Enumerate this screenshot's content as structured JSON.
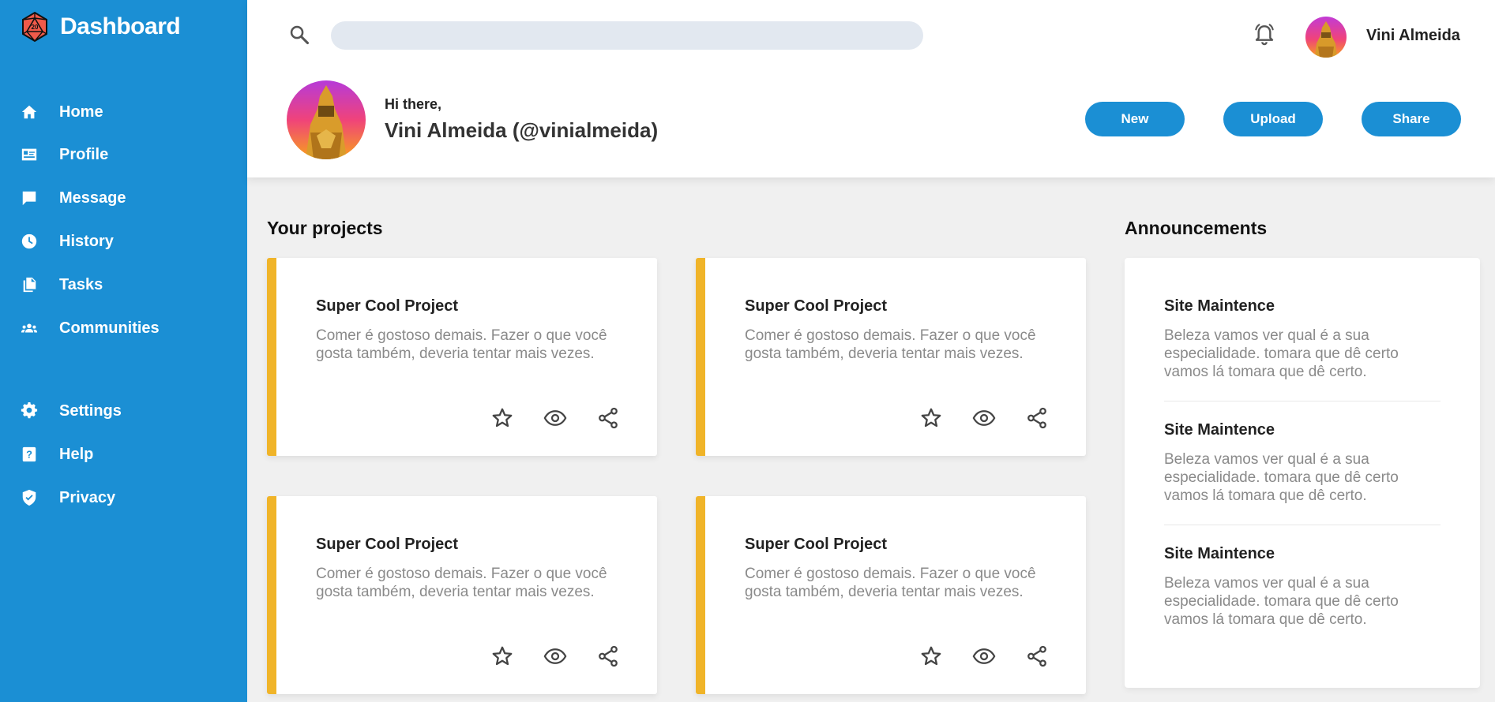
{
  "brand": {
    "title": "Dashboard",
    "logo_icon": "d20-dice-icon"
  },
  "sidebar": {
    "items": [
      {
        "label": "Home",
        "icon": "home-icon"
      },
      {
        "label": "Profile",
        "icon": "id-card-icon"
      },
      {
        "label": "Message",
        "icon": "chat-icon"
      },
      {
        "label": "History",
        "icon": "clock-icon"
      },
      {
        "label": "Tasks",
        "icon": "documents-icon"
      },
      {
        "label": "Communities",
        "icon": "group-icon"
      },
      {
        "label": "Settings",
        "icon": "gear-icon"
      },
      {
        "label": "Help",
        "icon": "help-icon"
      },
      {
        "label": "Privacy",
        "icon": "shield-icon"
      }
    ]
  },
  "header": {
    "search": {
      "value": "",
      "placeholder": ""
    },
    "user": {
      "name": "Vini Almeida"
    },
    "greeting": "Hi there,",
    "fullname": "Vini Almeida (@vinialmeida)",
    "buttons": {
      "new": "New",
      "upload": "Upload",
      "share": "Share"
    }
  },
  "projects": {
    "title": "Your projects",
    "cards": [
      {
        "title": "Super Cool Project",
        "description": "Comer é gostoso demais. Fazer o que você gosta também, deveria tentar mais vezes."
      },
      {
        "title": "Super Cool Project",
        "description": "Comer é gostoso demais. Fazer o que você gosta também, deveria tentar mais vezes."
      },
      {
        "title": "Super Cool Project",
        "description": "Comer é gostoso demais. Fazer o que você gosta também, deveria tentar mais vezes."
      },
      {
        "title": "Super Cool Project",
        "description": "Comer é gostoso demais. Fazer o que você gosta também, deveria tentar mais vezes."
      }
    ],
    "action_icons": [
      "star-icon",
      "eye-icon",
      "share-icon"
    ]
  },
  "announcements": {
    "title": "Announcements",
    "items": [
      {
        "title": "Site Maintence",
        "description": "Beleza vamos ver qual é a sua especialidade. tomara que dê certo vamos lá tomara que dê certo."
      },
      {
        "title": "Site Maintence",
        "description": "Beleza vamos ver qual é a sua especialidade. tomara que dê certo vamos lá tomara que dê certo."
      },
      {
        "title": "Site Maintence",
        "description": "Beleza vamos ver qual é a sua especialidade. tomara que dê certo vamos lá tomara que dê certo."
      }
    ]
  },
  "colors": {
    "primary": "#1b8fd4",
    "accent": "#f0b429",
    "background": "#f0f0f0"
  }
}
